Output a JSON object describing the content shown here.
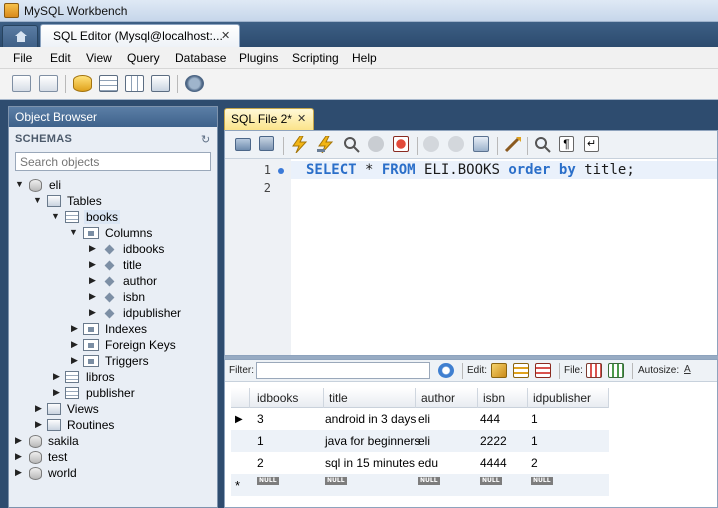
{
  "window": {
    "title": "MySQL Workbench"
  },
  "tabs": {
    "editor_tab_label": "SQL Editor (Mysql@localhost:...",
    "close_glyph": "✕"
  },
  "menu": [
    "File",
    "Edit",
    "View",
    "Query",
    "Database",
    "Plugins",
    "Scripting",
    "Help"
  ],
  "object_browser": {
    "header": "Object Browser",
    "schemas_label": "SCHEMAS",
    "search_placeholder": "Search objects",
    "tree": {
      "eli": "eli",
      "tables": "Tables",
      "books": "books",
      "columns": "Columns",
      "col_idbooks": "idbooks",
      "col_title": "title",
      "col_author": "author",
      "col_isbn": "isbn",
      "col_idpublisher": "idpublisher",
      "indexes": "Indexes",
      "foreign_keys": "Foreign Keys",
      "triggers": "Triggers",
      "libros": "libros",
      "publisher": "publisher",
      "views": "Views",
      "routines": "Routines",
      "sakila": "sakila",
      "test": "test",
      "world": "world"
    }
  },
  "sql_editor": {
    "tab_label": "SQL File 2*",
    "close_glyph": "✕",
    "line_numbers": [
      "1",
      "2"
    ],
    "query_tokens": {
      "select": "SELECT",
      "star": " * ",
      "from": "FROM",
      "table": " ELI.BOOKS ",
      "order": "order",
      "sp": " ",
      "by": "by",
      "rest": " title;"
    }
  },
  "result": {
    "filter_label": "Filter:",
    "edit_label": "Edit:",
    "file_label": "File:",
    "autosize_label": "Autosize:",
    "columns": [
      "idbooks",
      "title",
      "author",
      "isbn",
      "idpublisher"
    ],
    "rows": [
      [
        "3",
        "android in 3 days",
        "eli",
        "444",
        "1"
      ],
      [
        "1",
        "java for beginners",
        "eli",
        "2222",
        "1"
      ],
      [
        "2",
        "sql in 15 minutes",
        "edu",
        "4444",
        "2"
      ]
    ],
    "null_label": "NULL",
    "current_row_marker": "▶",
    "new_row_marker": "*"
  },
  "colors": {
    "keyword": "#2b6fc9",
    "header_gradient_top": "#5b7ea6",
    "sql_tab": "#fbe38a"
  },
  "icons": [
    "house-icon",
    "new-sql-tab-icon",
    "open-sql-script-icon",
    "new-schema-icon",
    "new-table-icon",
    "new-view-icon",
    "new-routine-icon",
    "reconnect-icon",
    "open-file-icon",
    "save-icon",
    "execute-icon",
    "execute-current-icon",
    "explain-icon",
    "stop-icon",
    "toggle-error-icon",
    "commit-icon",
    "rollback-icon",
    "autocommit-icon",
    "beautify-icon",
    "find-icon",
    "invisible-chars-icon",
    "wrap-icon"
  ]
}
